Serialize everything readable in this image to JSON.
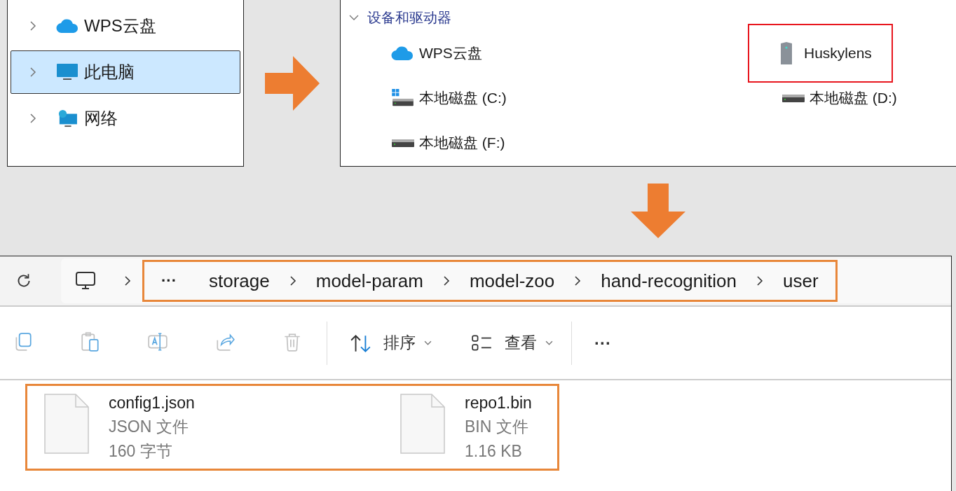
{
  "nav_tree": {
    "items": [
      {
        "label": "WPS云盘",
        "kind": "cloud",
        "selected": false
      },
      {
        "label": "此电脑",
        "kind": "monitor",
        "selected": true
      },
      {
        "label": "网络",
        "kind": "network",
        "selected": false
      }
    ]
  },
  "devices": {
    "group_title": "设备和驱动器",
    "expanded": true,
    "drives": [
      {
        "label": "WPS云盘",
        "kind": "cloud",
        "highlighted": false
      },
      {
        "label": "Huskylens",
        "kind": "device",
        "highlighted": true
      },
      {
        "label": "本地磁盘 (C:)",
        "kind": "system-disk",
        "highlighted": false
      },
      {
        "label": "本地磁盘 (D:)",
        "kind": "disk",
        "highlighted": false
      },
      {
        "label": "本地磁盘 (F:)",
        "kind": "disk",
        "highlighted": false
      }
    ]
  },
  "explorer": {
    "breadcrumb": {
      "overflow": "···",
      "parts": [
        "storage",
        "model-param",
        "model-zoo",
        "hand-recognition",
        "user"
      ],
      "highlighted": true
    },
    "toolbar": {
      "actions": [
        {
          "kind": "copy",
          "disabled": true
        },
        {
          "kind": "paste",
          "disabled": true
        },
        {
          "kind": "rename",
          "disabled": true
        },
        {
          "kind": "share",
          "disabled": true
        },
        {
          "kind": "delete",
          "disabled": true
        }
      ],
      "sort": "排序",
      "view": "查看",
      "more": "···"
    },
    "files_highlighted": true,
    "files": [
      {
        "name": "config1.json",
        "type": "JSON 文件",
        "size": "160 字节"
      },
      {
        "name": "repo1.bin",
        "type": "BIN 文件",
        "size": "1.16 KB"
      }
    ]
  }
}
